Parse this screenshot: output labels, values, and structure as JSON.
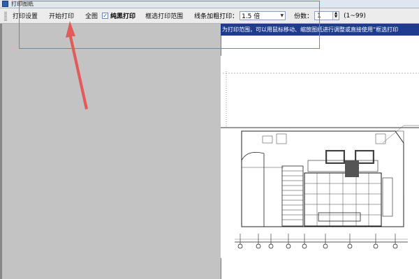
{
  "window": {
    "title": "打印图纸"
  },
  "toolbar": {
    "print_settings": "打印设置",
    "start_print": "开始打印",
    "full_view": "全图",
    "pure_black_label": "纯黑打印",
    "pure_black_checked": true,
    "frame_select": "框选打印范围",
    "line_thicken_label": "线条加粗打印：",
    "line_thicken_value": "1.5 倍",
    "copies_label": "份数：",
    "copies_value": "1",
    "copies_range": "(1~99)"
  },
  "hint": {
    "text": "为打印范围，可以用鼠标移动、缩放图纸进行调整或直接使用“框选打印"
  },
  "colors": {
    "hint_bar": "#1f3b8f",
    "annotation_red": "#e25a5a",
    "gray_workspace": "#c3c3c3"
  },
  "icons": [
    "app-icon",
    "checkbox-check-icon",
    "dropdown-arrow-icon",
    "spinner-arrows-icon",
    "annotation-arrow-icon"
  ]
}
